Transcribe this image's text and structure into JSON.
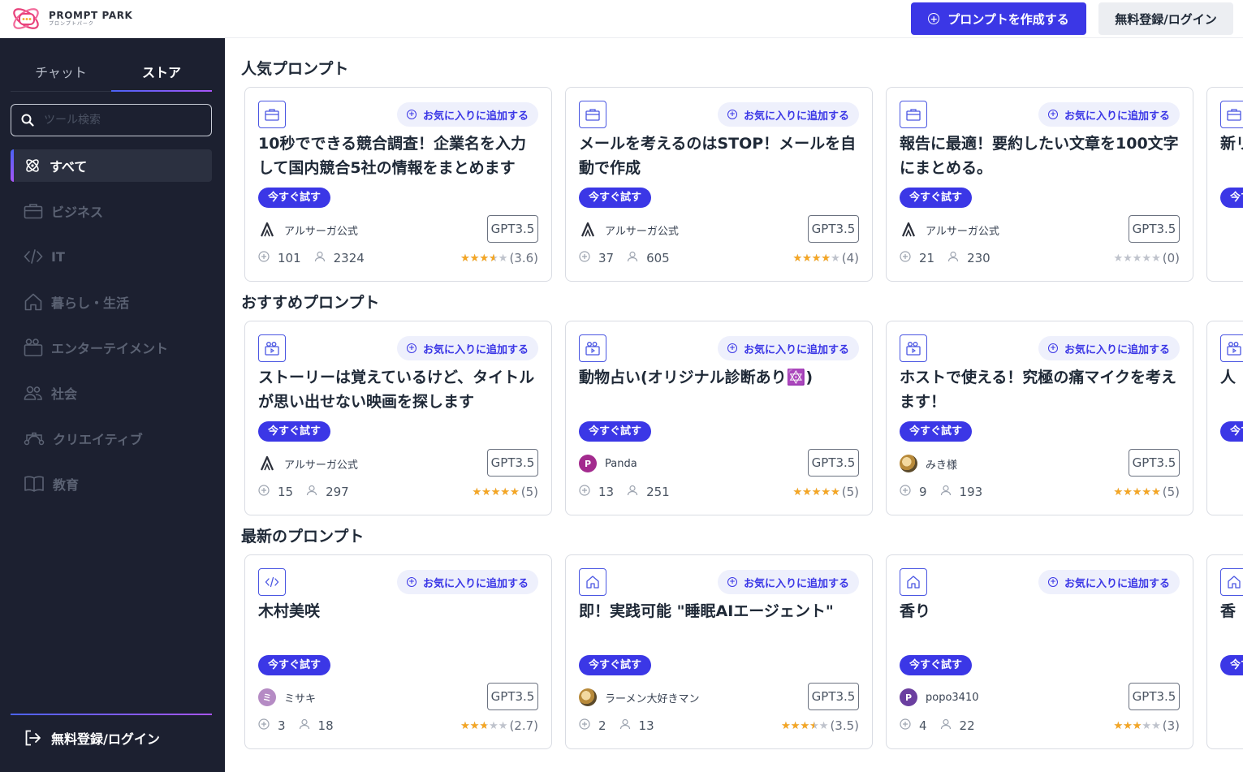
{
  "header": {
    "logo_title": "PROMPT PARK",
    "logo_subtitle": "プロンプトパーク",
    "create_button": "プロンプトを作成する",
    "login_button": "無料登録/ログイン"
  },
  "sidebar": {
    "tabs": [
      "チャット",
      "ストア"
    ],
    "active_tab": "ストア",
    "search_placeholder": "ツール検索",
    "items": [
      {
        "label": "すべて",
        "icon": "atom-icon",
        "active": true
      },
      {
        "label": "ビジネス",
        "icon": "briefcase-icon",
        "active": false
      },
      {
        "label": "IT",
        "icon": "code-icon",
        "active": false
      },
      {
        "label": "暮らし・生活",
        "icon": "home-icon",
        "active": false
      },
      {
        "label": "エンターテイメント",
        "icon": "entertainment-icon",
        "active": false
      },
      {
        "label": "社会",
        "icon": "people-icon",
        "active": false
      },
      {
        "label": "クリエイティブ",
        "icon": "creative-icon",
        "active": false
      },
      {
        "label": "教育",
        "icon": "book-icon",
        "active": false
      }
    ],
    "login_label": "無料登録/ログイン"
  },
  "labels": {
    "favorite": "お気に入りに追加する",
    "try_now": "今すぐ試す"
  },
  "sections": [
    {
      "title": "人気プロンプト",
      "cards": [
        {
          "category_icon": "briefcase-icon",
          "title": "10秒でできる競合調査！企業名を入力して国内競合5社の情報をまとめます",
          "author": "アルサーガ公式",
          "avatar": "alsaga",
          "model": "GPT3.5",
          "uses": "101",
          "users": "2324",
          "rating": 3.6,
          "rating_text": "(3.6)"
        },
        {
          "category_icon": "briefcase-icon",
          "title": "メールを考えるのはSTOP！メールを自動で作成",
          "author": "アルサーガ公式",
          "avatar": "alsaga",
          "model": "GPT3.5",
          "uses": "37",
          "users": "605",
          "rating": 4,
          "rating_text": "(4)"
        },
        {
          "category_icon": "briefcase-icon",
          "title": "報告に最適！要約したい文章を100文字にまとめる。",
          "author": "アルサーガ公式",
          "avatar": "alsaga",
          "model": "GPT3.5",
          "uses": "21",
          "users": "230",
          "rating": 0,
          "rating_text": "(0)"
        },
        {
          "category_icon": "briefcase-icon",
          "title": "新リ",
          "author": "",
          "avatar": "alsaga",
          "model": "",
          "uses": "",
          "users": "",
          "rating": 0,
          "rating_text": ""
        }
      ]
    },
    {
      "title": "おすすめプロンプト",
      "cards": [
        {
          "category_icon": "entertainment-icon",
          "title": "ストーリーは覚えているけど、タイトルが思い出せない映画を探します",
          "author": "アルサーガ公式",
          "avatar": "alsaga",
          "model": "GPT3.5",
          "uses": "15",
          "users": "297",
          "rating": 5,
          "rating_text": "(5)"
        },
        {
          "category_icon": "entertainment-icon",
          "title": "動物占い(オリジナル診断あり🔯)",
          "author": "Panda",
          "avatar": "P",
          "avatar_color": "#a32b8e",
          "model": "GPT3.5",
          "uses": "13",
          "users": "251",
          "rating": 5,
          "rating_text": "(5)"
        },
        {
          "category_icon": "entertainment-icon",
          "title": "ホストで使える！究極の痛マイクを考えます！",
          "author": "みき様",
          "avatar": "photo",
          "model": "GPT3.5",
          "uses": "9",
          "users": "193",
          "rating": 5,
          "rating_text": "(5)"
        },
        {
          "category_icon": "entertainment-icon",
          "title": "人",
          "author": "",
          "avatar": "photo",
          "model": "",
          "uses": "",
          "users": "",
          "rating": 0,
          "rating_text": ""
        }
      ]
    },
    {
      "title": "最新のプロンプト",
      "cards": [
        {
          "category_icon": "code-icon",
          "title": "木村美咲",
          "author": "ミサキ",
          "avatar": "ミ",
          "avatar_color": "#b58bc4",
          "model": "GPT3.5",
          "uses": "3",
          "users": "18",
          "rating": 2.7,
          "rating_text": "(2.7)"
        },
        {
          "category_icon": "home-icon",
          "title": "即！実践可能 \"睡眠AIエージェント\"",
          "author": "ラーメン大好きマン",
          "avatar": "photo",
          "model": "GPT3.5",
          "uses": "2",
          "users": "13",
          "rating": 3.5,
          "rating_text": "(3.5)"
        },
        {
          "category_icon": "home-icon",
          "title": "香り",
          "author": "popo3410",
          "avatar": "P",
          "avatar_color": "#6b3fa0",
          "model": "GPT3.5",
          "uses": "4",
          "users": "22",
          "rating": 3,
          "rating_text": "(3)"
        },
        {
          "category_icon": "home-icon",
          "title": "香",
          "author": "",
          "avatar": "P",
          "avatar_color": "#6b3fa0",
          "model": "",
          "uses": "",
          "users": "",
          "rating": 0,
          "rating_text": ""
        }
      ]
    }
  ],
  "colors": {
    "accent": "#3b37e6",
    "sidebar_bg": "#1c2030",
    "star": "#f5a623"
  }
}
